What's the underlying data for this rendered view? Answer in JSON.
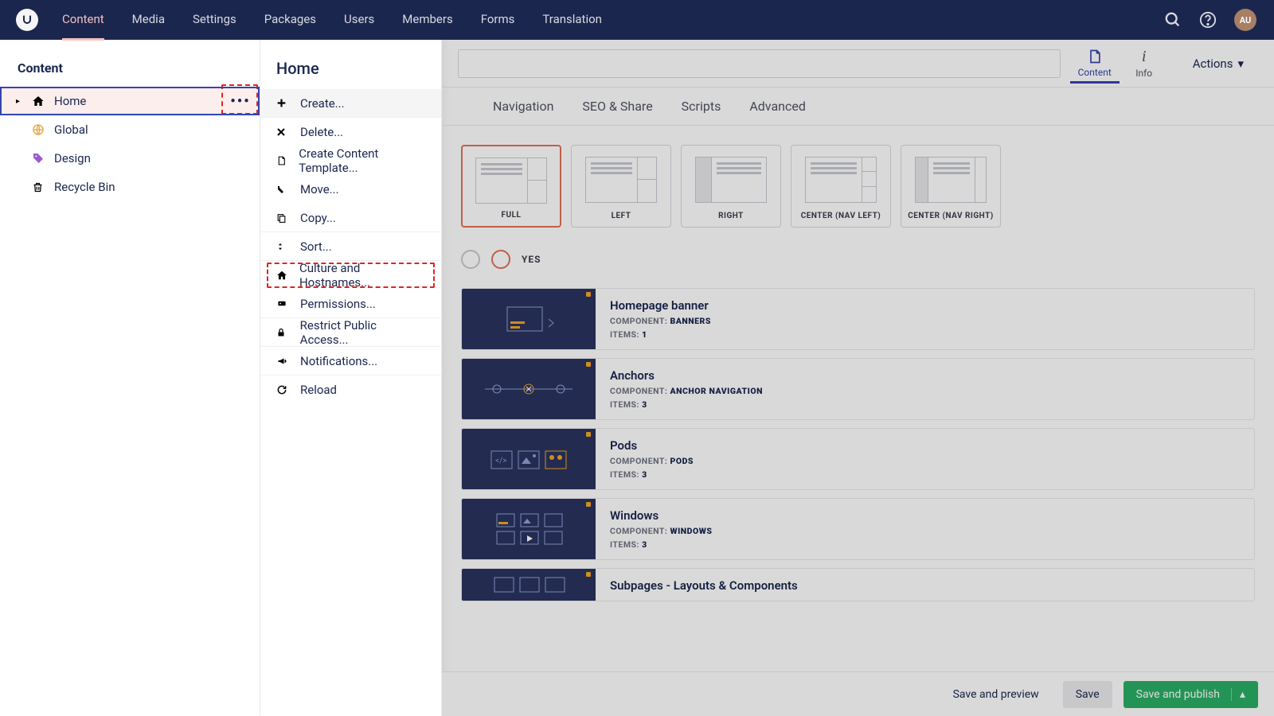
{
  "topnav": {
    "tabs": [
      "Content",
      "Media",
      "Settings",
      "Packages",
      "Users",
      "Members",
      "Forms",
      "Translation"
    ],
    "avatar": "AU"
  },
  "sidebar": {
    "title": "Content",
    "tree": [
      {
        "label": "Home",
        "icon": "home",
        "selected": true,
        "expandable": true
      },
      {
        "label": "Global",
        "icon": "globe"
      },
      {
        "label": "Design",
        "icon": "tag"
      },
      {
        "label": "Recycle Bin",
        "icon": "trash"
      }
    ]
  },
  "context": {
    "title": "Home",
    "items": [
      {
        "label": "Create...",
        "icon": "plus",
        "hover": true
      },
      {
        "label": "Delete...",
        "icon": "x"
      },
      {
        "label": "Create Content Template...",
        "icon": "doc"
      },
      {
        "label": "Move...",
        "icon": "move"
      },
      {
        "label": "Copy...",
        "icon": "copy"
      },
      {
        "label": "Sort...",
        "icon": "sort"
      },
      {
        "label": "Culture and Hostnames...",
        "icon": "home",
        "highlight": true
      },
      {
        "label": "Permissions...",
        "icon": "perm"
      },
      {
        "label": "Restrict Public Access...",
        "icon": "lock"
      },
      {
        "label": "Notifications...",
        "icon": "bull"
      },
      {
        "label": "Reload",
        "icon": "reload"
      }
    ]
  },
  "editor": {
    "title_value": "",
    "view_tabs": [
      {
        "label": "Content",
        "active": true
      },
      {
        "label": "Info"
      }
    ],
    "actions": "Actions",
    "tabs": [
      "",
      "Navigation",
      "SEO & Share",
      "Scripts",
      "Advanced"
    ],
    "layouts": [
      "FULL",
      "LEFT",
      "RIGHT",
      "CENTER (NAV LEFT)",
      "CENTER (NAV RIGHT)"
    ],
    "yes": "YES",
    "components": [
      {
        "title": "Homepage banner",
        "type": "BANNERS",
        "items": "1"
      },
      {
        "title": "Anchors",
        "type": "ANCHOR NAVIGATION",
        "items": "3"
      },
      {
        "title": "Pods",
        "type": "PODS",
        "items": "3"
      },
      {
        "title": "Windows",
        "type": "WINDOWS",
        "items": "3"
      },
      {
        "title": "Subpages - Layouts & Components",
        "type": "",
        "items": ""
      }
    ],
    "comp_label": "COMPONENT:",
    "items_label": "ITEMS:"
  },
  "footer": {
    "preview": "Save and preview",
    "save": "Save",
    "publish": "Save and publish"
  }
}
